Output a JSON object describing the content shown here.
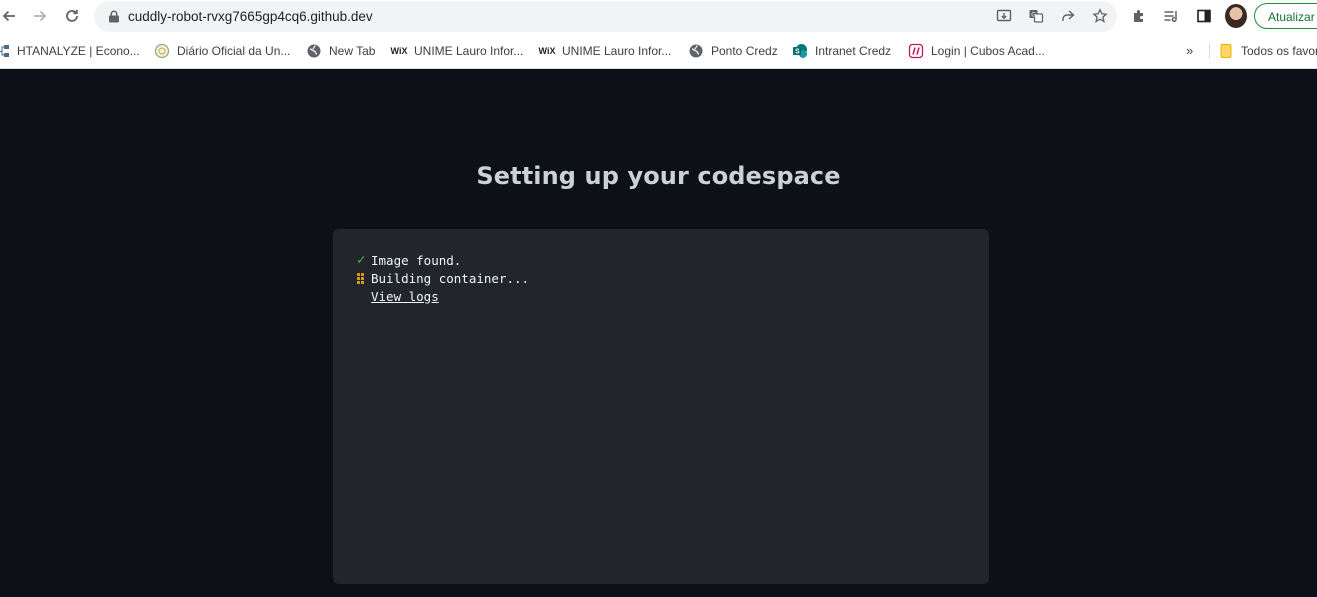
{
  "browser": {
    "url": "cuddly-robot-rvxg7665gp4cq6.github.dev",
    "update_button": "Atualizar",
    "icons": [
      "back-arrow-icon",
      "forward-arrow-icon",
      "reload-icon",
      "lock-icon",
      "install-app-icon",
      "translate-icon",
      "share-icon",
      "star-icon",
      "extensions-icon",
      "reading-list-icon",
      "side-panel-icon",
      "profile-avatar"
    ]
  },
  "bookmarks": {
    "items": [
      {
        "label": "HTANALYZE | Econo...",
        "icon": "sitemap-icon"
      },
      {
        "label": "Diário Oficial da Un...",
        "icon": "seal-icon"
      },
      {
        "label": "New Tab",
        "icon": "globe-icon"
      },
      {
        "label": "UNIME Lauro Infor...",
        "icon": "wix-icon"
      },
      {
        "label": "UNIME Lauro Infor...",
        "icon": "wix-icon"
      },
      {
        "label": "Ponto Credz",
        "icon": "globe-icon"
      },
      {
        "label": "Intranet Credz",
        "icon": "sharepoint-icon"
      },
      {
        "label": "Login | Cubos Acad...",
        "icon": "cubos-icon"
      }
    ],
    "overflow": "»",
    "all_bookmarks": "Todos os favoritos"
  },
  "page": {
    "title": "Setting up your codespace",
    "steps": [
      {
        "status": "done",
        "text": "Image found."
      },
      {
        "status": "in-progress",
        "text": "Building container..."
      }
    ],
    "view_logs": "View logs"
  },
  "colors": {
    "background": "#0d1117",
    "panel": "#22262b",
    "success": "#3fb950",
    "progress": "#d29922"
  }
}
